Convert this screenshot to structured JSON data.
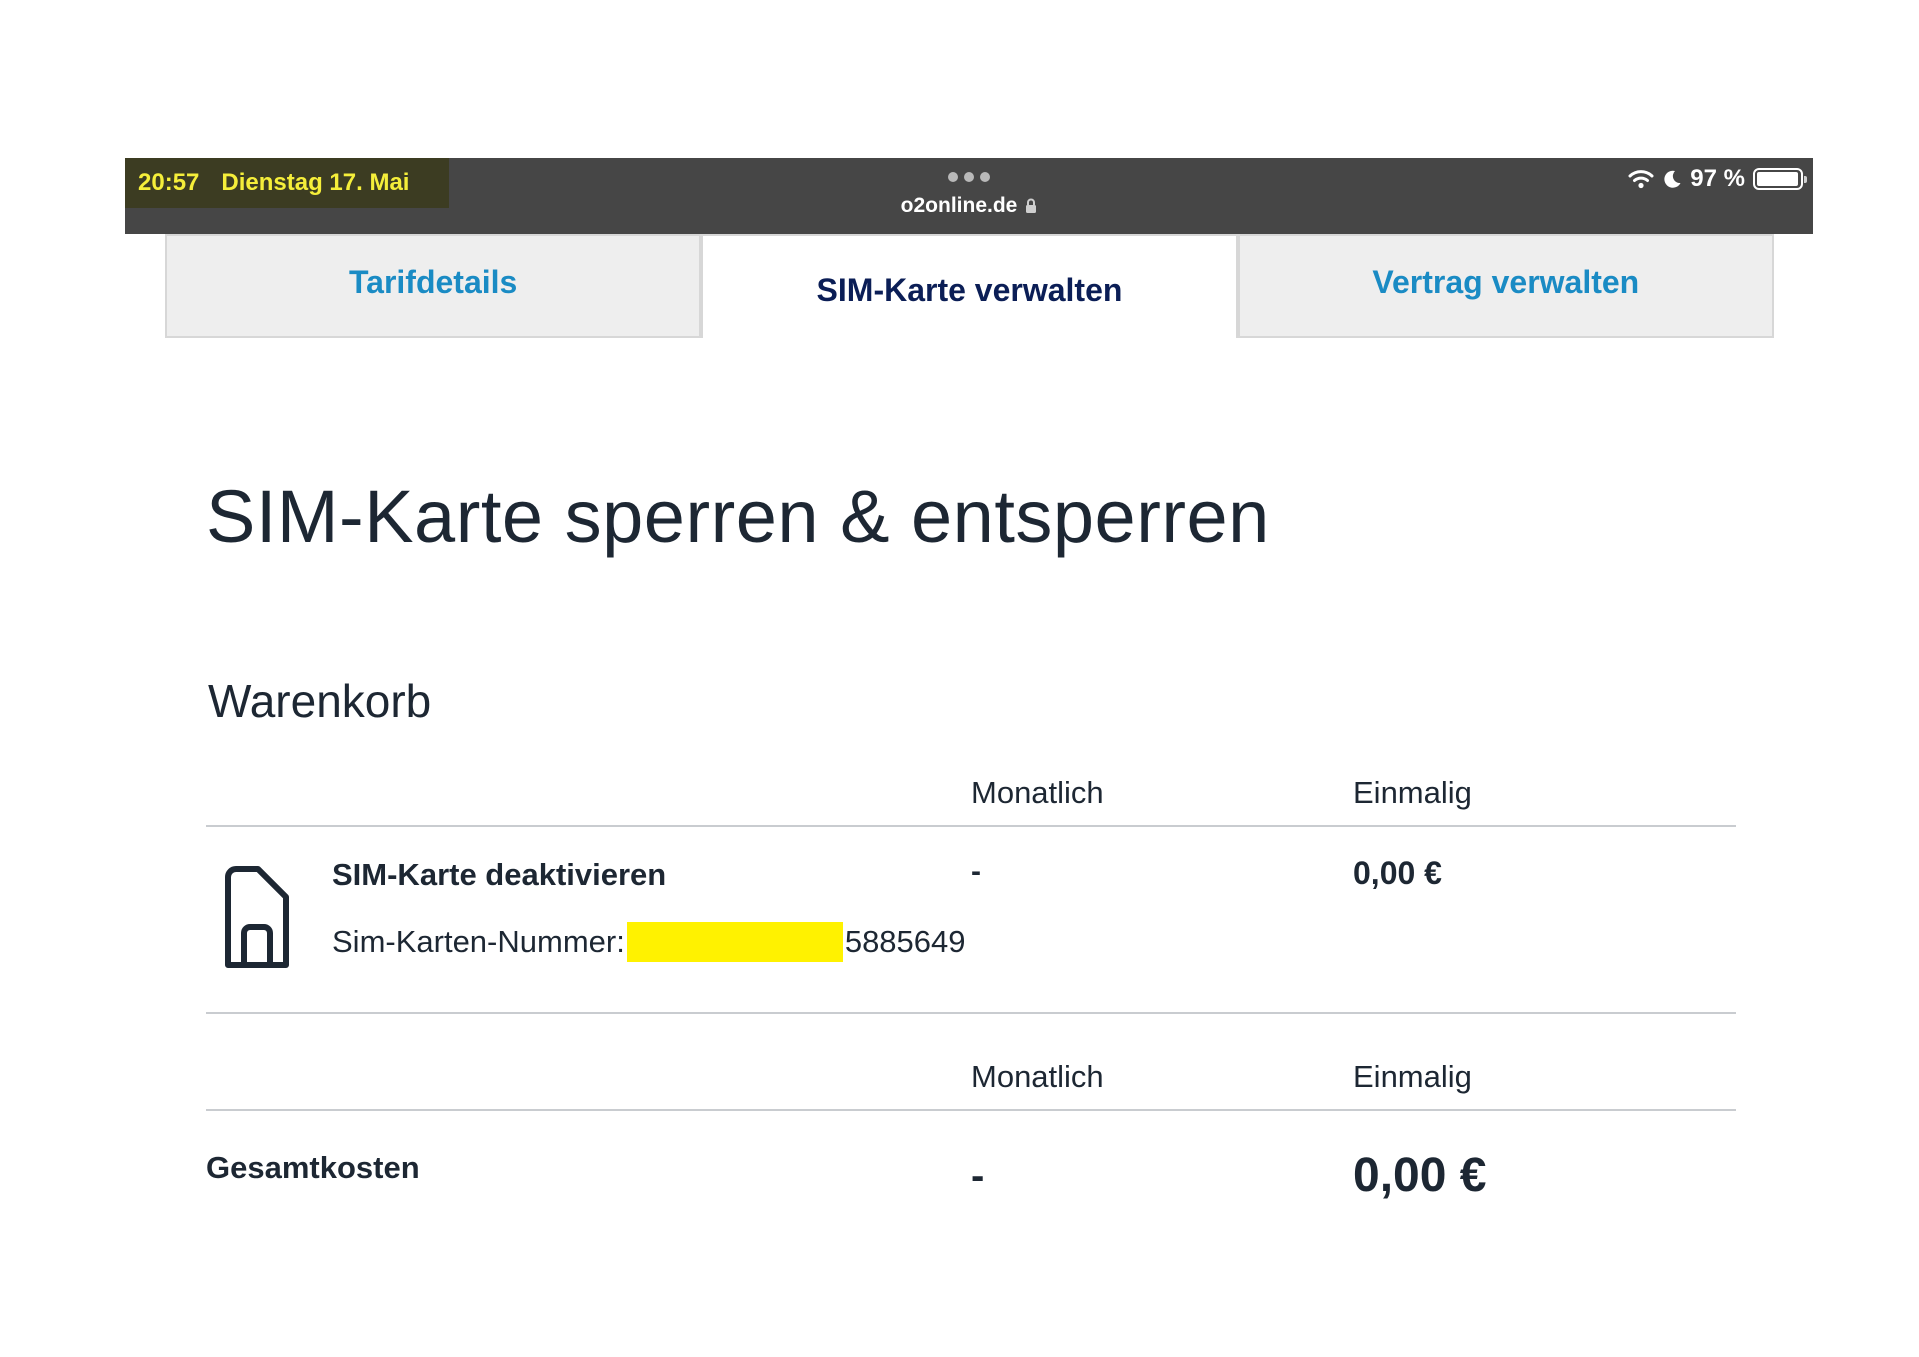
{
  "status_bar": {
    "time": "20:57",
    "date": "Dienstag 17. Mai",
    "url": "o2online.de",
    "battery": "97 %",
    "battery_level": 0.97
  },
  "tabs": [
    {
      "label": "Tarifdetails",
      "active": false
    },
    {
      "label": "SIM-Karte verwalten",
      "active": true
    },
    {
      "label": "Vertrag verwalten",
      "active": false
    }
  ],
  "main": {
    "title": "SIM-Karte sperren & entsperren",
    "cart_title": "Warenkorb",
    "columns": {
      "monthly": "Monatlich",
      "once": "Einmalig"
    },
    "item": {
      "title": "SIM-Karte deaktivieren",
      "sim_number_label": "Sim-Karten-Nummer:",
      "sim_number_suffix": "5885649",
      "monthly": "-",
      "once": "0,00 €"
    },
    "total": {
      "label": "Gesamtkosten",
      "monthly": "-",
      "once": "0,00 €"
    }
  },
  "colors": {
    "status_bar_bg": "#464646",
    "highlight_text": "#f5ee3a",
    "tab_inactive_text": "#1a8bc4",
    "tab_active_text": "#0b1e56",
    "redaction": "#fff200"
  }
}
